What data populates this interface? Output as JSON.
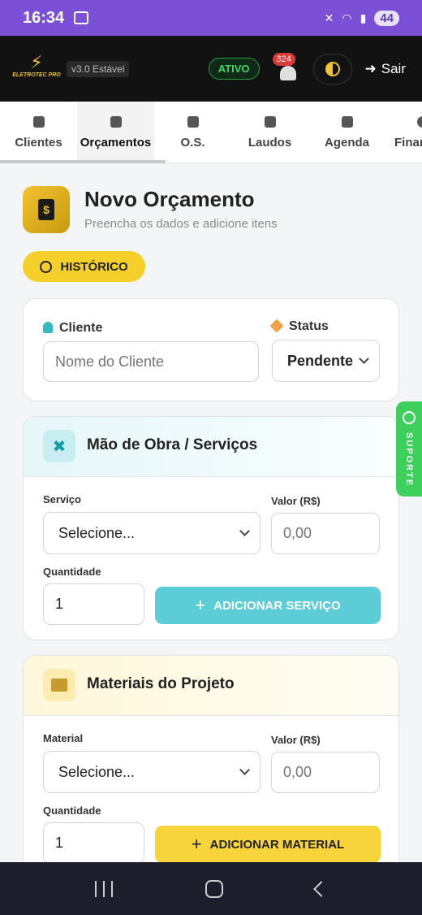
{
  "status_bar": {
    "time": "16:34",
    "battery": "44"
  },
  "app_header": {
    "brand": "ELETROTEC PRO",
    "version": "v3.0 Estável",
    "status_badge": "ATIVO",
    "notification_count": "324",
    "logout_label": "Sair"
  },
  "tabs": [
    {
      "label": "Clientes",
      "icon": "users-icon"
    },
    {
      "label": "Orçamentos",
      "icon": "invoice-icon",
      "active": true
    },
    {
      "label": "O.S.",
      "icon": "clipboard-icon"
    },
    {
      "label": "Laudos",
      "icon": "report-icon"
    },
    {
      "label": "Agenda",
      "icon": "calendar-icon"
    },
    {
      "label": "Finar",
      "icon": "finance-icon"
    }
  ],
  "page": {
    "title": "Novo Orçamento",
    "subtitle": "Preencha os dados e adicione itens",
    "history_button": "HISTÓRICO"
  },
  "client_card": {
    "client_label": "Cliente",
    "client_placeholder": "Nome do Cliente",
    "status_label": "Status",
    "status_value": "Pendente"
  },
  "services_card": {
    "title": "Mão de Obra / Serviços",
    "service_label": "Serviço",
    "service_value": "Selecione...",
    "value_label": "Valor (R$)",
    "value_placeholder": "0,00",
    "qty_label": "Quantidade",
    "qty_value": "1",
    "add_button": "ADICIONAR SERVIÇO"
  },
  "materials_card": {
    "title": "Materiais do Projeto",
    "material_label": "Material",
    "material_value": "Selecione...",
    "value_label": "Valor (R$)",
    "value_placeholder": "0,00",
    "qty_label": "Quantidade",
    "qty_value": "1",
    "add_button": "ADICIONAR MATERIAL"
  },
  "support_tab": {
    "label": "SUPORTE"
  },
  "colors": {
    "accent": "#f5cf2a",
    "teal": "#5ccdd6",
    "header_bg": "#121212",
    "status_bar": "#7b4fd6",
    "active_green": "#44d36a"
  }
}
